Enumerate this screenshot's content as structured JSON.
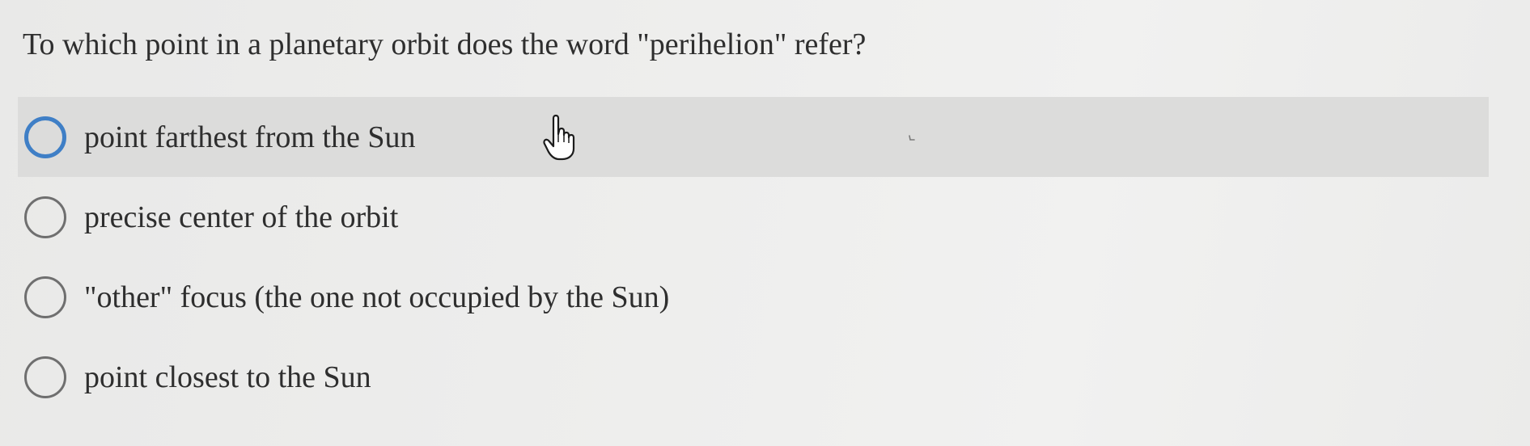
{
  "question": {
    "text": "To which point in a planetary orbit does the word \"perihelion\" refer?"
  },
  "options": [
    {
      "label": "point farthest from the Sun",
      "selected": false,
      "hovered": true
    },
    {
      "label": "precise center of the orbit",
      "selected": false,
      "hovered": false
    },
    {
      "label": "\"other\" focus (the one not occupied by the Sun)",
      "selected": false,
      "hovered": false
    },
    {
      "label": "point closest to the Sun",
      "selected": false,
      "hovered": false
    }
  ],
  "colors": {
    "radio_hover_border": "#3f7fc6",
    "radio_border": "#6f6f6f",
    "hover_row_bg": "#dcdcdb",
    "page_bg": "#eeeeed"
  },
  "icons": {
    "cursor": "hand-pointer-icon"
  }
}
